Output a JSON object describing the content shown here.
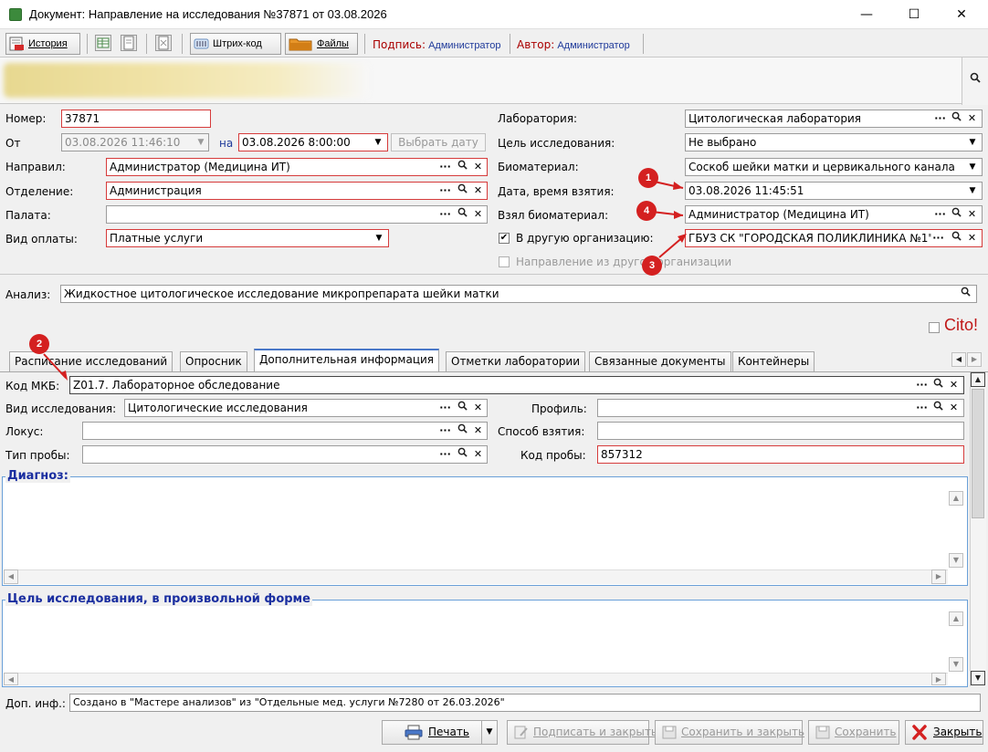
{
  "window": {
    "title": "Документ: Направление на исследования №37871 от 03.08.2026",
    "minimize": "—",
    "maximize": "☐",
    "close": "✕"
  },
  "toolbar": {
    "history_label": "История",
    "barcode_label": "Штрих-код",
    "files_label": "Файлы",
    "signature_label": "Подпись:",
    "signature_value": "Администратор",
    "author_label": "Автор:",
    "author_value": "Администратор"
  },
  "form": {
    "number_label": "Номер:",
    "number_value": "37871",
    "from_label": "От",
    "from_value": "03.08.2026 11:46:10",
    "on_label": "на",
    "on_value": "03.08.2026 8:00:00",
    "choose_date_label": "Выбрать дату",
    "directed_label": "Направил:",
    "directed_value": "Администратор (Медицина ИТ)",
    "department_label": "Отделение:",
    "department_value": "Администрация",
    "ward_label": "Палата:",
    "ward_value": "",
    "payment_label": "Вид оплаты:",
    "payment_value": "Платные услуги",
    "lab_label": "Лаборатория:",
    "lab_value": "Цитологическая лаборатория",
    "goal_label": "Цель исследования:",
    "goal_value": "Не выбрано",
    "biomaterial_label": "Биоматериал:",
    "biomaterial_value": "Соскоб шейки матки и цервикального канала",
    "taken_date_label": "Дата, время взятия:",
    "taken_date_value": "03.08.2026 11:45:51",
    "taken_by_label": "Взял биоматериал:",
    "taken_by_value": "Администратор (Медицина ИТ)",
    "other_org_label": "В другую организацию:",
    "other_org_value": "ГБУЗ СК \"ГОРОДСКАЯ ПОЛИКЛИНИКА №1\"",
    "from_other_org_label": "Направление из другой организации",
    "analysis_label": "Анализ:",
    "analysis_value": "Жидкостное цитологическое исследование микропрепарата шейки матки",
    "cito_label": "Cito!"
  },
  "markers": [
    "1",
    "2",
    "3",
    "4"
  ],
  "tabs": [
    {
      "label": "Расписание исследований"
    },
    {
      "label": "Опросник"
    },
    {
      "label": "Дополнительная информация"
    },
    {
      "label": "Отметки лаборатории"
    },
    {
      "label": "Связанные документы"
    },
    {
      "label": "Контейнеры"
    }
  ],
  "tab_content": {
    "mkb_label": "Код МКБ:",
    "mkb_value": "Z01.7. Лабораторное обследование",
    "study_type_label": "Вид исследования:",
    "study_type_value": "Цитологические исследования",
    "profile_label": "Профиль:",
    "profile_value": "",
    "locus_label": "Локус:",
    "locus_value": "",
    "method_label": "Способ взятия:",
    "method_value": "",
    "sample_type_label": "Тип пробы:",
    "sample_type_value": "",
    "sample_code_label": "Код пробы:",
    "sample_code_value": "857312",
    "diagnosis_title": "Диагноз:",
    "goal_free_title": "Цель исследования, в произвольной форме"
  },
  "footer": {
    "extra_label": "Доп. инф.:",
    "extra_value": "Создано в \"Мастере анализов\" из \"Отдельные мед. услуги №7280 от 26.03.2026\"",
    "print_label": "Печать",
    "sign_close_label": "Подписать и закрыть",
    "save_close_label": "Сохранить и закрыть",
    "save_label": "Сохранить",
    "close_label": "Закрыть"
  },
  "icons": {
    "dots": "···",
    "search": "🔍",
    "clear": "✕",
    "dropdown": "▼",
    "check": "✔"
  }
}
